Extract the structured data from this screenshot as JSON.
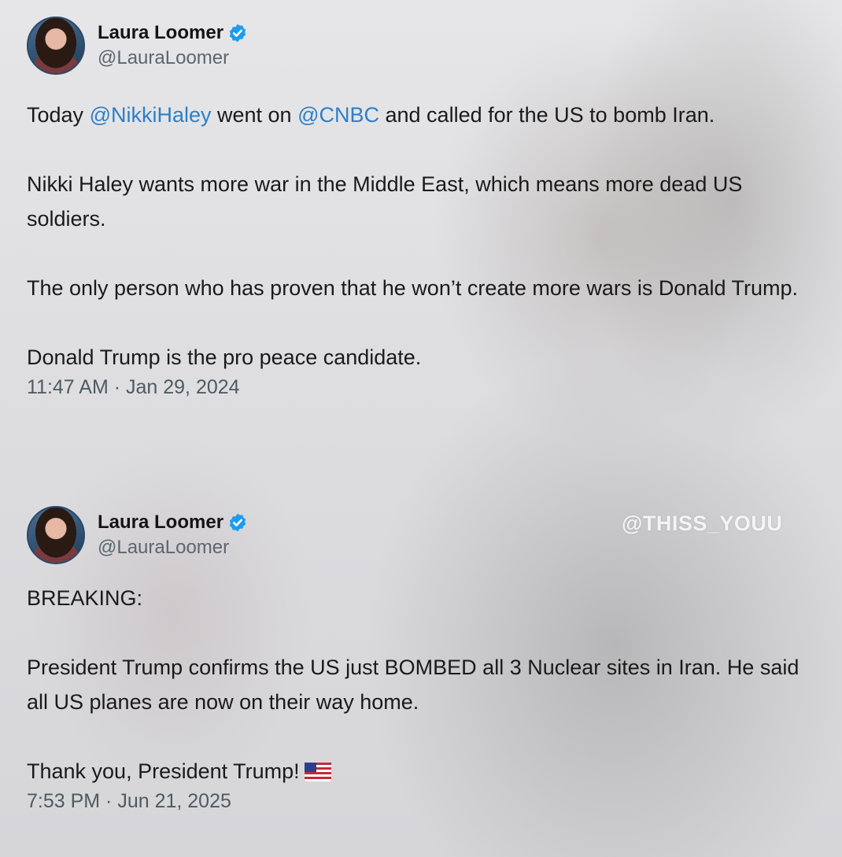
{
  "watermark": "@THISS_YOUU",
  "tweets": [
    {
      "display_name": "Laura Loomer",
      "handle": "@LauraLoomer",
      "verified_icon": "verified-badge-icon",
      "text": {
        "p1_a": "Today ",
        "p1_mention1": "@NikkiHaley",
        "p1_b": " went on ",
        "p1_mention2": "@CNBC",
        "p1_c": " and called for the US to bomb Iran.",
        "p2": "Nikki Haley wants more war in the Middle East, which means more dead US soldiers.",
        "p3": "The only person who has proven that he won’t create more wars is Donald Trump.",
        "p4": "Donald Trump is the pro peace candidate."
      },
      "timestamp": "11:47 AM · Jan 29, 2024"
    },
    {
      "display_name": "Laura Loomer",
      "handle": "@LauraLoomer",
      "verified_icon": "verified-badge-icon",
      "text": {
        "p1": "BREAKING:",
        "p2": "President Trump confirms the US just BOMBED all 3 Nuclear sites in Iran. He said all US planes are now on their way home.",
        "p3": "Thank you, President Trump!"
      },
      "flag_icon": "us-flag-icon",
      "timestamp": "7:53 PM · Jun 21, 2025"
    }
  ],
  "colors": {
    "link": "#2f7fc6",
    "verified": "#1d9bf0",
    "text": "#1a1a1a",
    "muted": "#5b6670"
  }
}
